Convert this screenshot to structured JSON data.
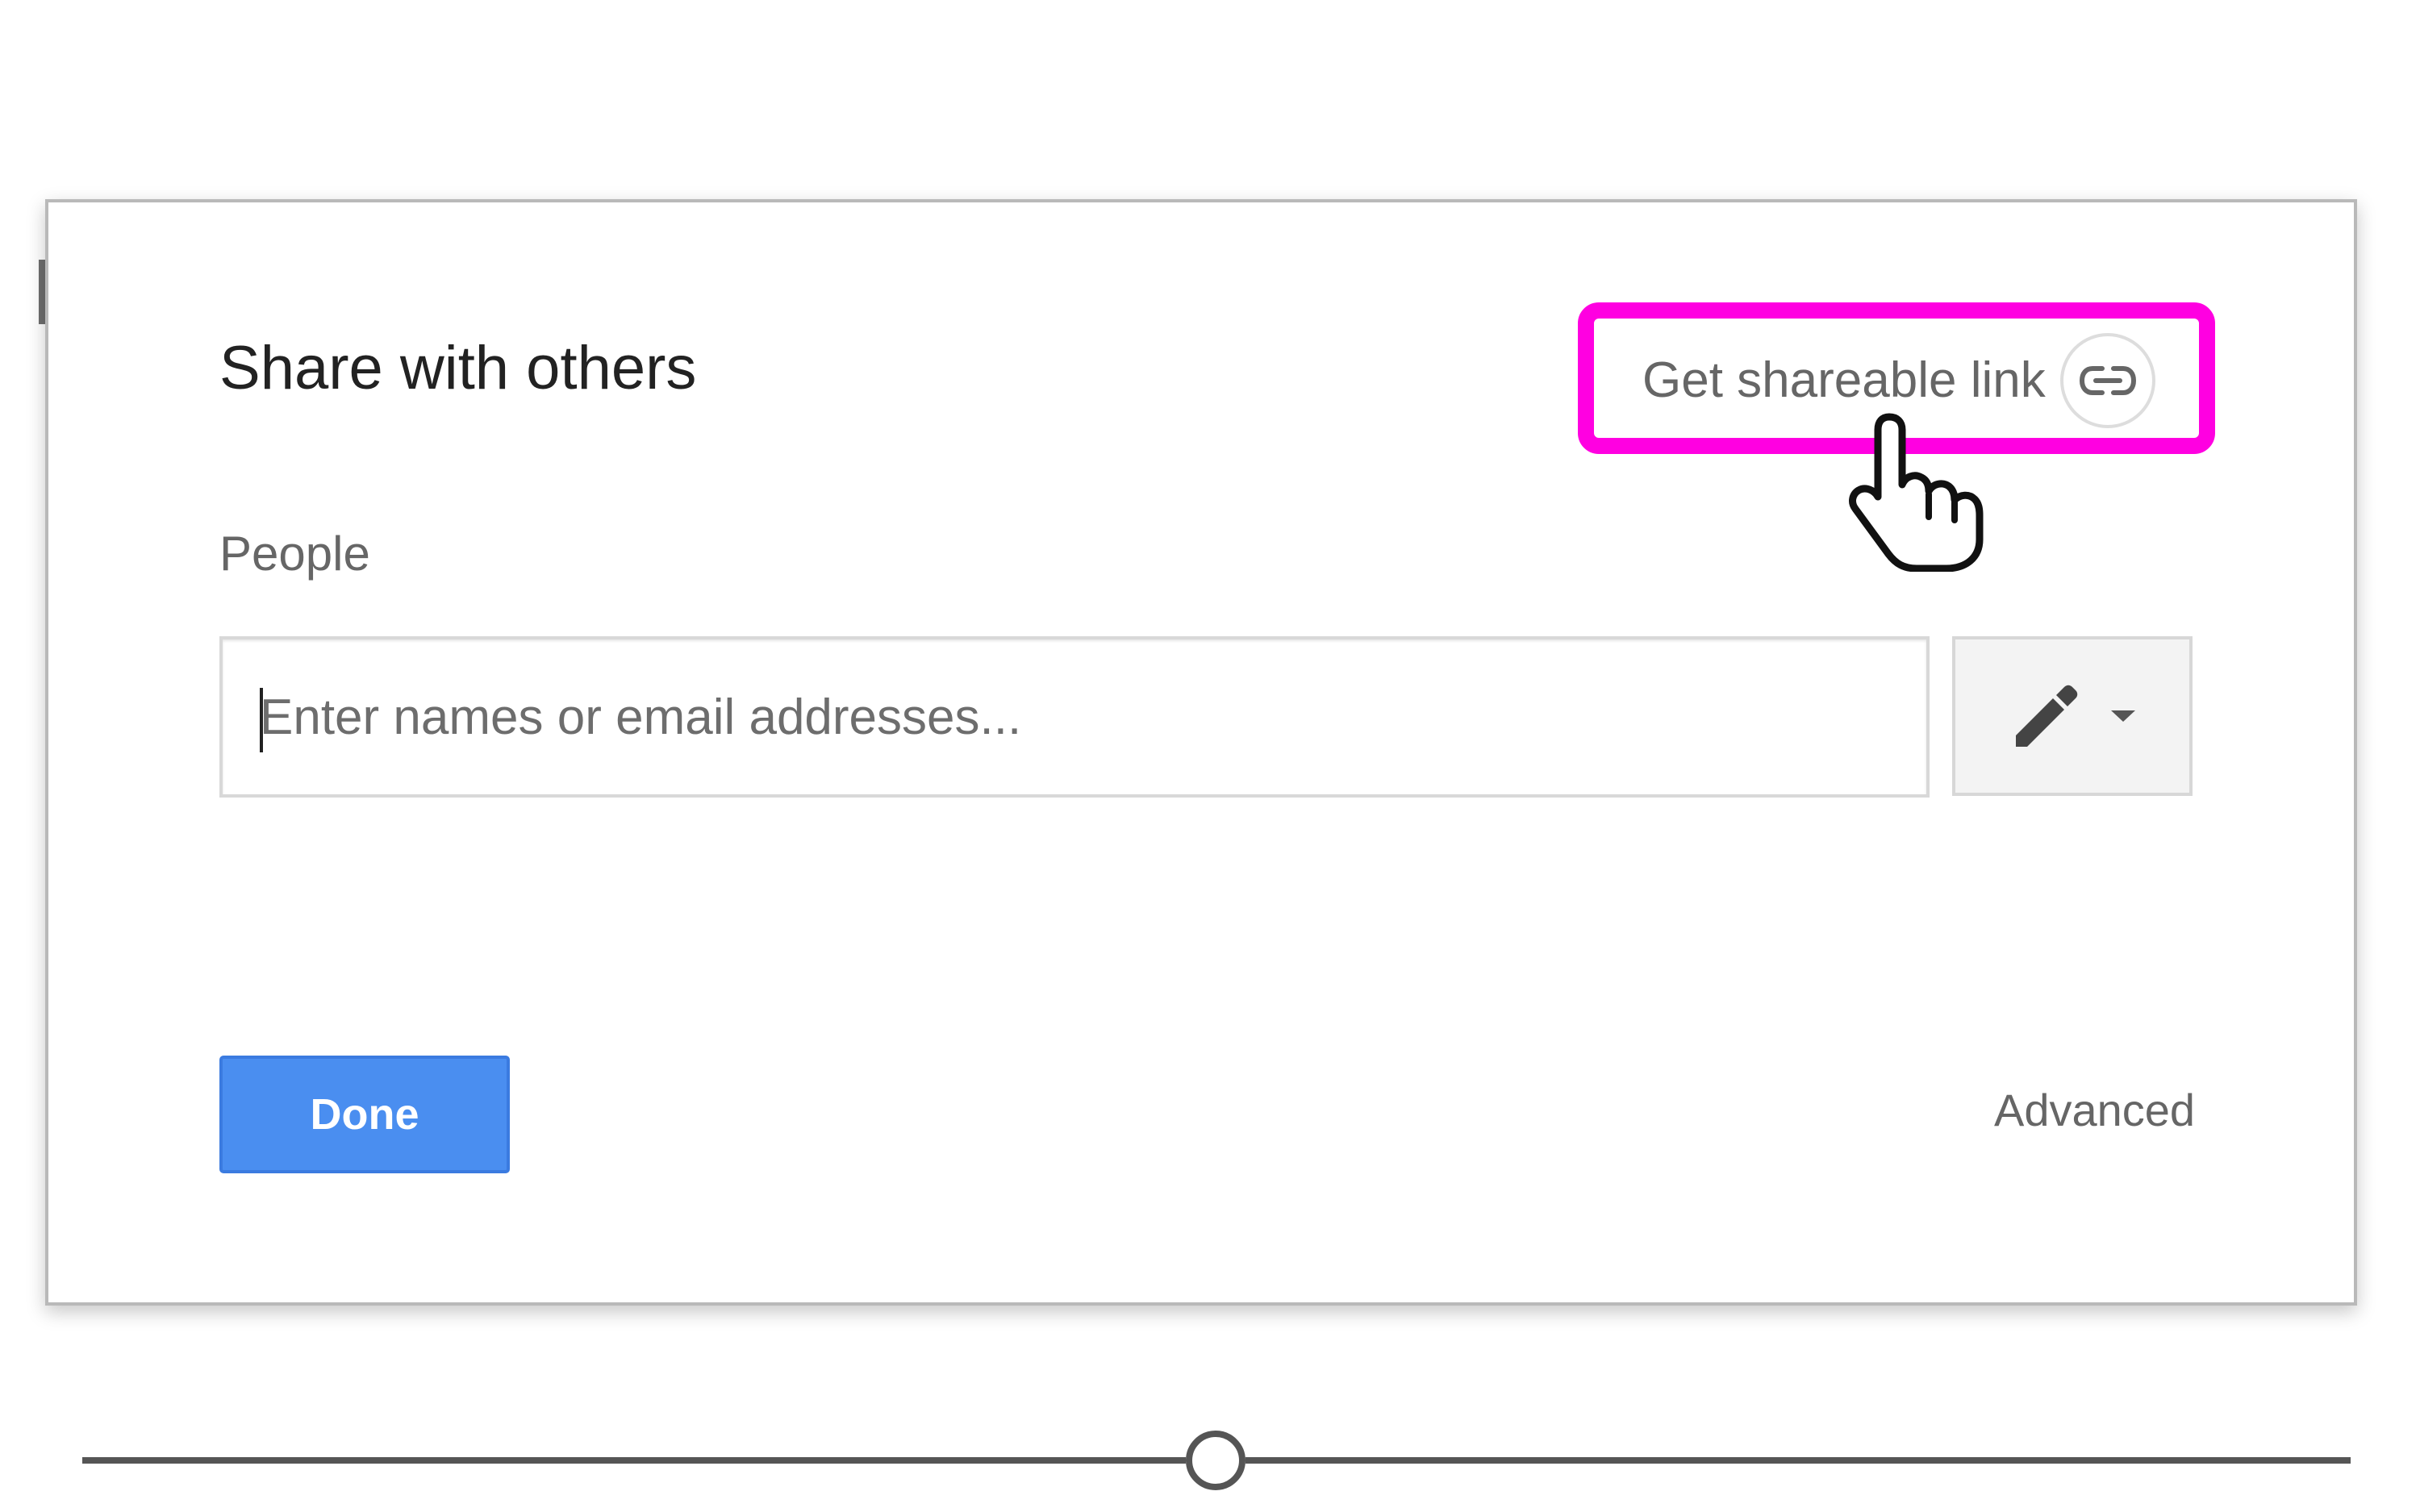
{
  "dialog": {
    "title": "Share with others",
    "shareable_link_label": "Get shareable link",
    "link_icon": "link-icon",
    "people_label": "People",
    "people_input": {
      "value": "",
      "placeholder": "Enter names or email addresses..."
    },
    "permission_icon": "pencil-icon",
    "permission_menu_icon": "dropdown-arrow-icon",
    "done_label": "Done",
    "advanced_label": "Advanced"
  },
  "annotation": {
    "highlight_color": "#ff00e1",
    "cursor_icon": "hand-pointer-icon"
  },
  "playback": {
    "progress": 0.5
  },
  "colors": {
    "primary_button": "#4a8ef0",
    "text_muted": "#666666",
    "text_dark": "#222222"
  }
}
